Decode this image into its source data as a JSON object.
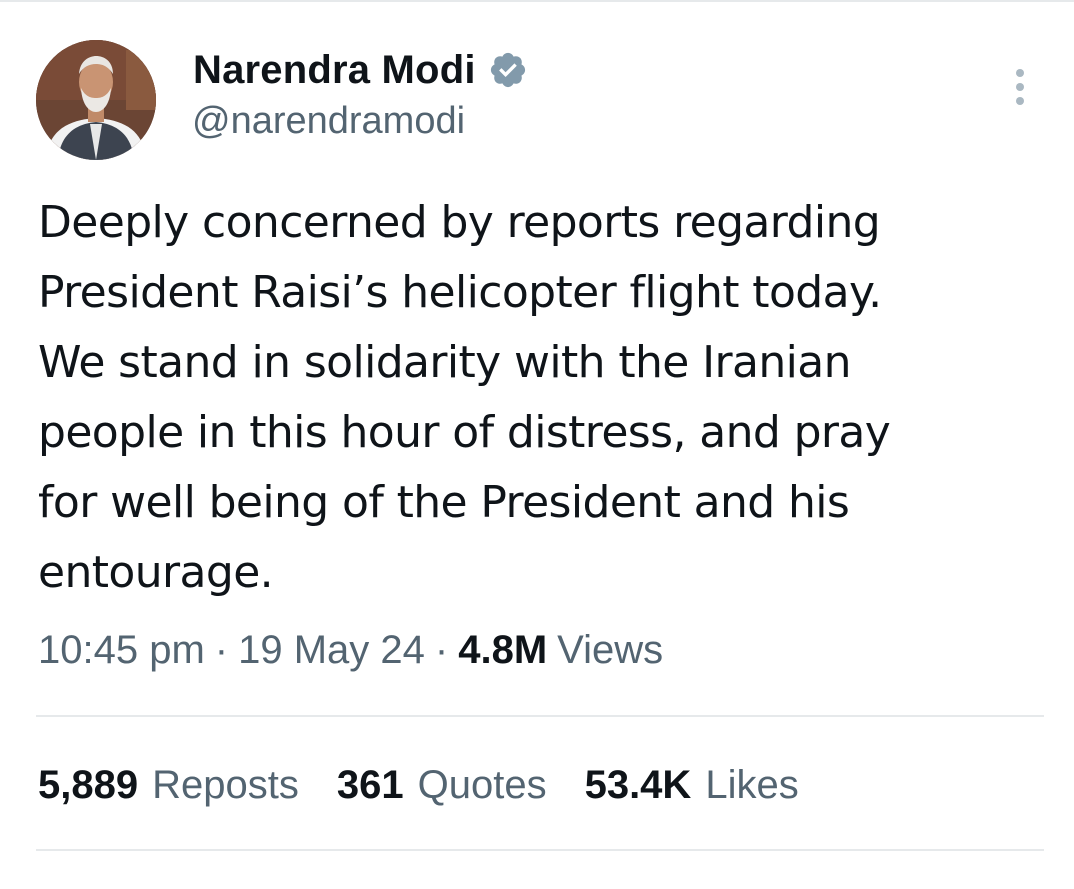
{
  "author": {
    "display_name": "Narendra Modi",
    "handle": "@narendramodi",
    "verified": true,
    "avatar_icon": "profile-photo",
    "verified_icon": "verified-badge-icon"
  },
  "tweet": {
    "lines": [
      "Deeply concerned by reports regarding",
      "President Raisi’s helicopter flight today.",
      "We stand in solidarity with the Iranian",
      "people in this hour of distress, and pray",
      "for well being of the President and his",
      "entourage."
    ]
  },
  "meta": {
    "time": "10:45 pm",
    "separator": "·",
    "date": "19 May 24",
    "views_count": "4.8M",
    "views_label": "Views"
  },
  "stats": {
    "reposts_count": "5,889",
    "reposts_label": "Reposts",
    "quotes_count": "361",
    "quotes_label": "Quotes",
    "likes_count": "53.4K",
    "likes_label": "Likes"
  },
  "colors": {
    "text": "#0f1419",
    "secondary": "#536471",
    "divider": "#e6e9eb",
    "verified_badge": "#829aab"
  }
}
